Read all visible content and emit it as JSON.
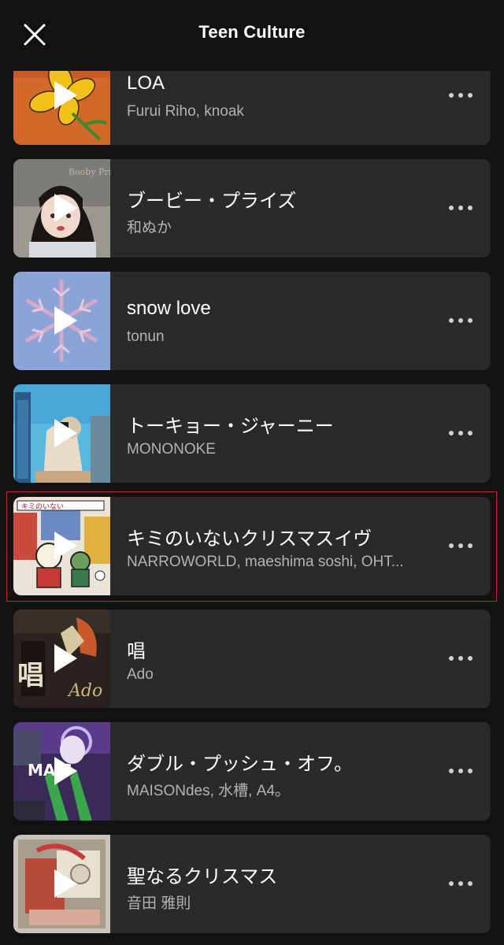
{
  "header": {
    "title": "Teen Culture"
  },
  "colors": {
    "background": "#121212",
    "card": "#2a2a2a",
    "title_text": "#ffffff",
    "subtitle_text": "#b3b3b3",
    "selection_outline": "#c0282a"
  },
  "tracks": [
    {
      "title": "LOA",
      "artist": "Furui Riho, knoak",
      "art_icon": "flower-cover-art"
    },
    {
      "title": "ブービー・プライズ",
      "artist": "和ぬか",
      "art_icon": "portrait-cover-art"
    },
    {
      "title": "snow love",
      "artist": "tonun",
      "art_icon": "snowflake-cover-art"
    },
    {
      "title": "トーキョー・ジャーニー",
      "artist": "MONONOKE",
      "art_icon": "city-cover-art"
    },
    {
      "title": "キミのいないクリスマスイヴ",
      "artist": "NARROWORLD, maeshima soshi, OHT...",
      "art_icon": "christmas-cover-art"
    },
    {
      "title": "唱",
      "artist": "Ado",
      "art_icon": "dark-cover-art"
    },
    {
      "title": "ダブル・プッシュ・オフ。",
      "artist": "MAISONdes, 水槽, A4。",
      "art_icon": "anime-cover-art"
    },
    {
      "title": "聖なるクリスマス",
      "artist": "音田 雅則",
      "art_icon": "gift-cover-art"
    }
  ],
  "selected_track_index": 4
}
